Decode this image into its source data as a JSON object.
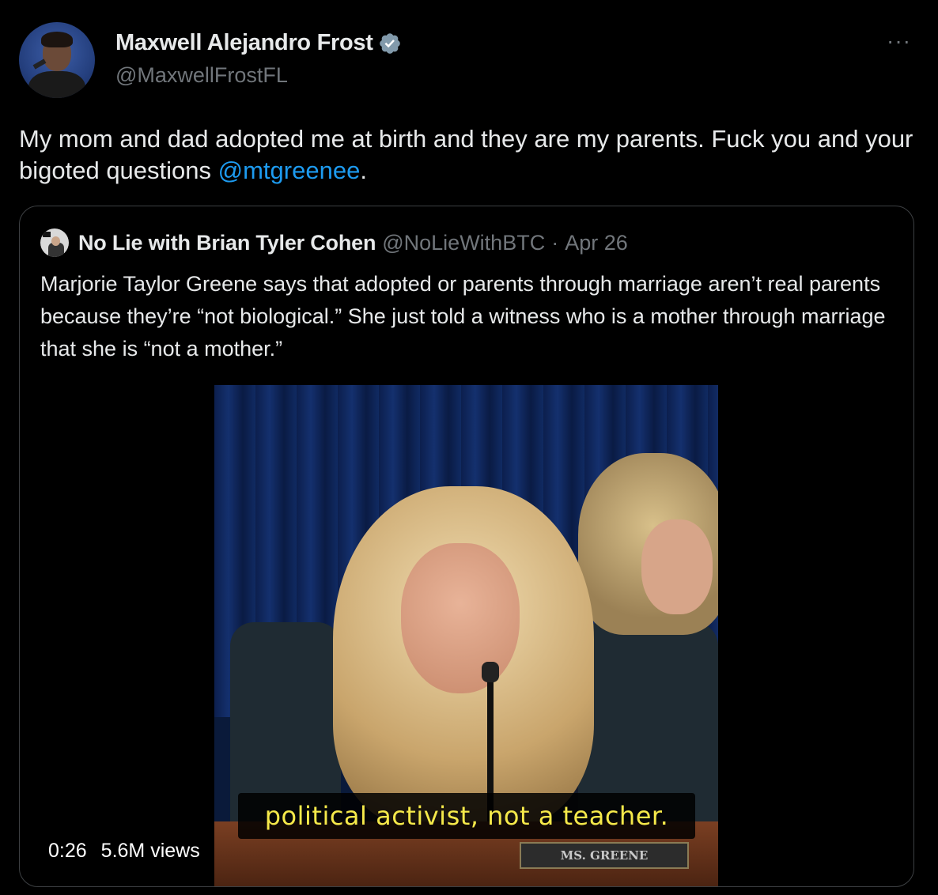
{
  "author": {
    "name": "Maxwell Alejandro Frost",
    "handle": "@MaxwellFrostFL",
    "verified": true
  },
  "more_icon": "···",
  "tweet": {
    "text_before": "My mom and dad adopted me at birth and they are my parents. Fuck you and your bigoted questions ",
    "mention": "@mtgreenee",
    "text_after": "."
  },
  "quote": {
    "name": "No Lie with Brian Tyler Cohen",
    "handle": "@NoLieWithBTC",
    "separator": "·",
    "date": "Apr 26",
    "text": "Marjorie Taylor Greene says that adopted or parents through marriage aren’t real parents because they’re “not biological.” She just told a witness who is a mother through marriage that she is “not a mother.”",
    "video": {
      "caption": "political activist, not a teacher.",
      "nameplate": "MS. GREENE",
      "duration": "0:26",
      "views": "5.6M views"
    }
  },
  "colors": {
    "background": "#000000",
    "text": "#e7e9ea",
    "secondary": "#71767b",
    "link": "#1d9bf0",
    "verified": "#829aab"
  }
}
